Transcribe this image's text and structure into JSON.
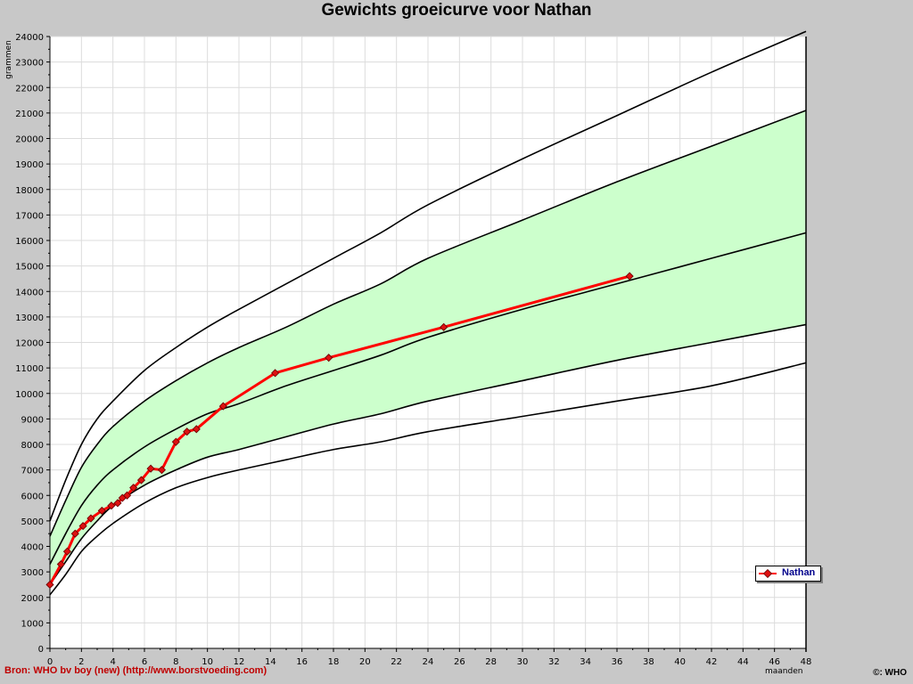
{
  "page": {
    "source_text": "Bron: WHO bv boy (new) (http://www.borstvoeding.com)",
    "credit_text": "©: WHO"
  },
  "chart_data": {
    "type": "line",
    "title": "Gewichts groeicurve voor Nathan",
    "xlabel": "maanden",
    "ylabel": "grammen",
    "xlim": [
      0,
      48
    ],
    "ylim": [
      0,
      24000
    ],
    "x_ticks": [
      0,
      2,
      4,
      6,
      8,
      10,
      12,
      14,
      16,
      18,
      20,
      22,
      24,
      26,
      28,
      30,
      32,
      34,
      36,
      38,
      40,
      42,
      44,
      46,
      48
    ],
    "y_ticks": [
      0,
      1000,
      2000,
      3000,
      4000,
      5000,
      6000,
      7000,
      8000,
      9000,
      10000,
      11000,
      12000,
      13000,
      14000,
      15000,
      16000,
      17000,
      18000,
      19000,
      20000,
      21000,
      22000,
      23000,
      24000
    ],
    "grid": true,
    "legend_position": "bottom-right",
    "colors": {
      "band": "#ccffcc",
      "reference": "#000000",
      "series": "#ff0000",
      "marker": "#dd1111",
      "legend_text": "#00008b",
      "background": "#c8c8c8",
      "plot_bg": "#ffffff"
    },
    "shaded_band": {
      "between": [
        "-2 SD",
        "+2 SD"
      ]
    },
    "reference_curves": [
      {
        "x": [
          0,
          1,
          2,
          3,
          4,
          6,
          8,
          10,
          12,
          15,
          18,
          21,
          24,
          30,
          36,
          42,
          48
        ],
        "values": [
          2100,
          2900,
          3800,
          4400,
          4900,
          5700,
          6300,
          6700,
          7000,
          7400,
          7800,
          8100,
          8500,
          9100,
          9700,
          10300,
          11200
        ]
      },
      {
        "x": [
          0,
          1,
          2,
          3,
          4,
          6,
          8,
          10,
          12,
          15,
          18,
          21,
          24,
          30,
          36,
          42,
          48
        ],
        "values": [
          2500,
          3400,
          4300,
          5000,
          5600,
          6400,
          7000,
          7500,
          7800,
          8300,
          8800,
          9200,
          9700,
          10500,
          11300,
          12000,
          12700
        ]
      },
      {
        "x": [
          0,
          1,
          2,
          3,
          4,
          6,
          8,
          10,
          12,
          15,
          18,
          21,
          24,
          30,
          36,
          42,
          48
        ],
        "values": [
          3300,
          4500,
          5600,
          6400,
          7000,
          7900,
          8600,
          9200,
          9600,
          10300,
          10900,
          11500,
          12200,
          13300,
          14300,
          15300,
          16300
        ]
      },
      {
        "x": [
          0,
          1,
          2,
          3,
          4,
          6,
          8,
          10,
          12,
          15,
          18,
          21,
          24,
          30,
          36,
          42,
          48
        ],
        "values": [
          4400,
          5800,
          7100,
          8000,
          8700,
          9700,
          10500,
          11200,
          11800,
          12600,
          13500,
          14300,
          15300,
          16800,
          18300,
          19700,
          21100
        ]
      },
      {
        "x": [
          0,
          1,
          2,
          3,
          4,
          6,
          8,
          10,
          12,
          15,
          18,
          21,
          24,
          30,
          36,
          42,
          48
        ],
        "values": [
          5000,
          6600,
          8000,
          9000,
          9700,
          10900,
          11800,
          12600,
          13300,
          14300,
          15300,
          16300,
          17400,
          19200,
          20900,
          22600,
          24200
        ]
      }
    ],
    "series": [
      {
        "name": "Nathan",
        "x": [
          0,
          0.7,
          1.1,
          1.6,
          2.1,
          2.6,
          3.3,
          3.9,
          4.3,
          4.6,
          4.9,
          5.3,
          5.8,
          6.4,
          7.1,
          8.0,
          8.7,
          9.3,
          11.0,
          14.3,
          17.7,
          25.0,
          36.8
        ],
        "values": [
          2500,
          3300,
          3800,
          4500,
          4800,
          5100,
          5400,
          5600,
          5700,
          5900,
          6000,
          6300,
          6600,
          7050,
          7000,
          8100,
          8500,
          8600,
          9500,
          10800,
          11400,
          12600,
          14600
        ]
      }
    ]
  }
}
